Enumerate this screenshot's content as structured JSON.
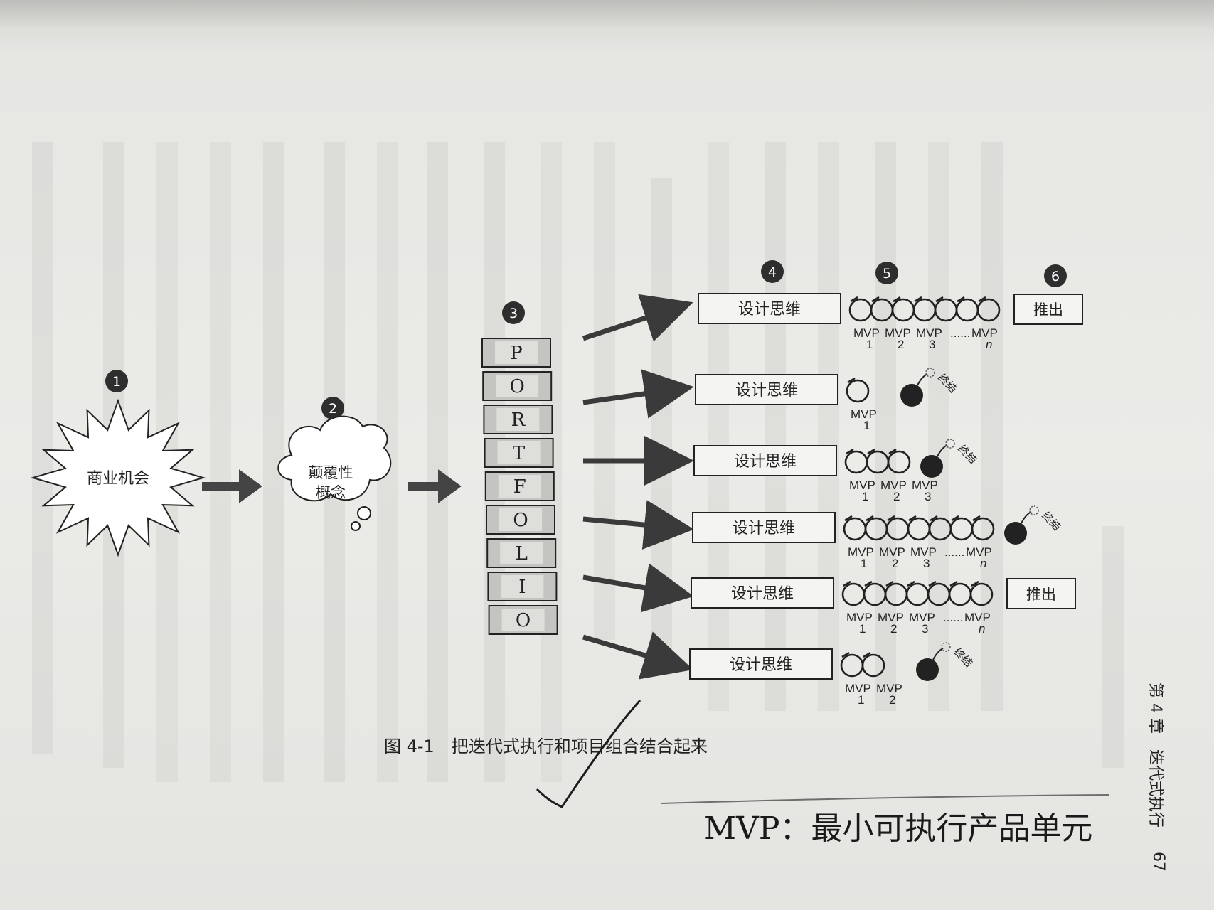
{
  "circle_numbers": [
    "1",
    "2",
    "3",
    "4",
    "5",
    "6"
  ],
  "opportunity_label": "商业机会",
  "concept_label": "颠覆性概念",
  "concept_lines": [
    "颠覆性",
    "概念"
  ],
  "portfolio_letters": [
    "P",
    "O",
    "R",
    "T",
    "F",
    "O",
    "L",
    "I",
    "O"
  ],
  "design_thinking_label": "设计思维",
  "launch_label": "推出",
  "terminate_label": "终结",
  "mvp_label": "MVP",
  "ellipsis": "......",
  "rows": [
    {
      "id": "row-1",
      "loops": 7,
      "mvps": [
        "1",
        "2",
        "3",
        "n"
      ],
      "ending": "launch"
    },
    {
      "id": "row-2",
      "loops": 1,
      "mvps": [
        "1"
      ],
      "ending": "terminate"
    },
    {
      "id": "row-3",
      "loops": 3,
      "mvps": [
        "1",
        "2",
        "3"
      ],
      "ending": "terminate"
    },
    {
      "id": "row-4",
      "loops": 7,
      "mvps": [
        "1",
        "2",
        "3",
        "n"
      ],
      "ending": "terminate"
    },
    {
      "id": "row-5",
      "loops": 7,
      "mvps": [
        "1",
        "2",
        "3",
        "n"
      ],
      "ending": "launch"
    },
    {
      "id": "row-6",
      "loops": 2,
      "mvps": [
        "1",
        "2"
      ],
      "ending": "terminate"
    }
  ],
  "figure_caption": "图 4-1　把迭代式执行和项目组合结合起来",
  "chapter_header": "第 4 章　迭代式执行",
  "page_number": "67",
  "handwritten_note": "MVP：最小可执行产品单元"
}
